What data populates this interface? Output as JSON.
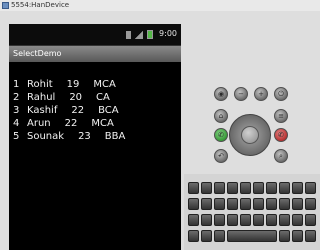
{
  "window": {
    "title": "5554:HanDevice"
  },
  "statusbar": {
    "clock": "9:00"
  },
  "app": {
    "title": "SelectDemo"
  },
  "rows": [
    {
      "id": "1",
      "name": "Rohit",
      "age": "19",
      "course": "MCA"
    },
    {
      "id": "2",
      "name": "Rahul",
      "age": "20",
      "course": "CA"
    },
    {
      "id": "3",
      "name": "Kashif",
      "age": "22",
      "course": "BCA"
    },
    {
      "id": "4",
      "name": "Arun",
      "age": "22",
      "course": "MCA"
    },
    {
      "id": "5",
      "name": "Sounak",
      "age": "23",
      "course": "BBA"
    }
  ],
  "icons": {
    "sim": "sim-card-icon",
    "signal": "signal-icon",
    "battery": "battery-icon",
    "home": "home-icon",
    "menu": "menu-icon",
    "back": "back-icon",
    "search": "search-icon",
    "call": "call-icon",
    "end_call": "end-call-icon",
    "volume_down": "volume-down-icon",
    "volume_up": "volume-up-icon",
    "power": "power-icon",
    "camera": "camera-icon"
  },
  "colors": {
    "call": "#3a9a3a",
    "end_call": "#b83232",
    "battery": "#55b848"
  }
}
